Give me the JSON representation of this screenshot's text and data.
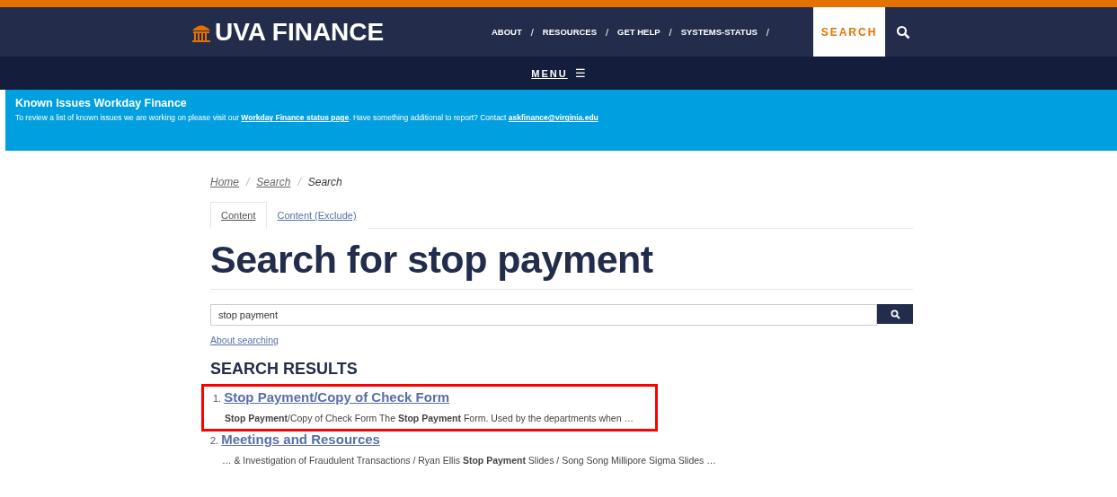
{
  "header": {
    "logo": "UVA FINANCE",
    "nav": [
      {
        "label": "ABOUT",
        "separator": "/"
      },
      {
        "label": "RESOURCES",
        "separator": "/"
      },
      {
        "label": "GET HELP",
        "separator": "/"
      },
      {
        "label": "SYSTEMS-STATUS",
        "separator": "/"
      }
    ],
    "search_button": "SEARCH"
  },
  "menu_bar": {
    "label": "MENU",
    "icon": "☰"
  },
  "banner": {
    "title": "Known Issues Workday Finance",
    "text_parts": [
      {
        "kind": "text",
        "text": "To review a list of known issues we are working on please visit our "
      },
      {
        "kind": "link",
        "text": "Workday Finance status page"
      },
      {
        "kind": "text",
        "text": ".  Have something additional to report?  Contact "
      },
      {
        "kind": "link",
        "text": "askfinance@virginia.edu"
      }
    ]
  },
  "breadcrumbs": [
    {
      "label": "Home",
      "link": true,
      "separator": "/"
    },
    {
      "label": "Search",
      "link": true,
      "separator": "/"
    },
    {
      "label": "Search",
      "link": false
    }
  ],
  "tabs": [
    {
      "label": "Content",
      "selected": true
    },
    {
      "label": "Content (Exclude)",
      "selected": false
    }
  ],
  "page_title": "Search for stop payment",
  "search": {
    "value": "stop payment"
  },
  "about_link": "About searching",
  "results_heading": "SEARCH RESULTS",
  "results": [
    {
      "number": "1.",
      "title": "Stop Payment/Copy of Check Form",
      "snippet": "**Stop Payment**/Copy of Check Form The **Stop Payment** Form.   Used by the departments when …",
      "highlighted": true
    },
    {
      "number": "2.",
      "title": "Meetings and Resources",
      "snippet": "… & Investigation of Fraudulent Transactions / Ryan Ellis **Stop Payment** Slides / Song Song Millipore Sigma Slides …",
      "highlighted": false
    }
  ]
}
